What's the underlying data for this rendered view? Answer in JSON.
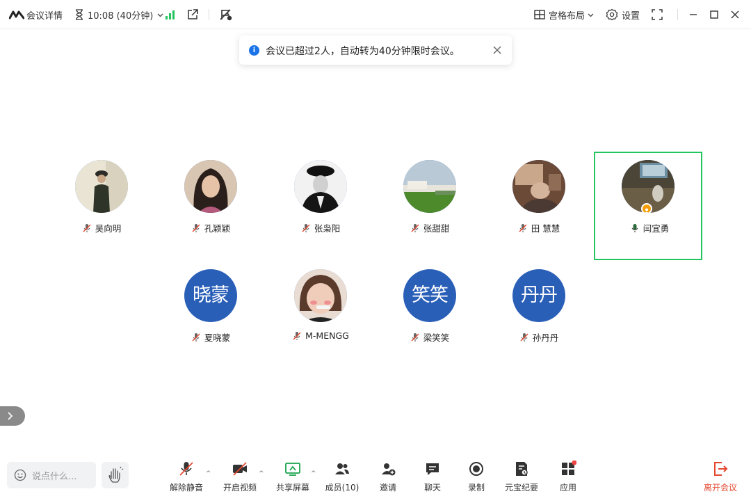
{
  "topbar": {
    "meeting_details": "会议详情",
    "timer": "10:08 (40分钟)",
    "layout": "宫格布局",
    "settings": "设置"
  },
  "toast": {
    "message": "会议已超过2人，自动转为40分钟限时会议。"
  },
  "participants": [
    {
      "name": "吴向明",
      "avatar": "photo",
      "mic": "muted"
    },
    {
      "name": "孔颖颖",
      "avatar": "photo",
      "mic": "muted"
    },
    {
      "name": "张枭阳",
      "avatar": "photo",
      "mic": "muted"
    },
    {
      "name": "张甜甜",
      "avatar": "photo",
      "mic": "muted"
    },
    {
      "name": "田 慧慧",
      "avatar": "photo",
      "mic": "muted"
    },
    {
      "name": "闫宜勇",
      "avatar": "photo",
      "mic": "on",
      "active": true,
      "host": true
    },
    {
      "name": "夏晓蒙",
      "avatar": "initials",
      "initials": "晓蒙",
      "mic": "muted"
    },
    {
      "name": "M-MENGG",
      "avatar": "photo",
      "mic": "muted"
    },
    {
      "name": "梁笑笑",
      "avatar": "initials",
      "initials": "笑笑",
      "mic": "muted"
    },
    {
      "name": "孙丹丹",
      "avatar": "initials",
      "initials": "丹丹",
      "mic": "muted"
    }
  ],
  "bottombar": {
    "chat_placeholder": "说点什么...",
    "tools": {
      "unmute": "解除静音",
      "start_video": "开启视频",
      "share_screen": "共享屏幕",
      "members": "成员(10)",
      "invite": "邀请",
      "chat": "聊天",
      "record": "录制",
      "ai_notes": "元宝纪要",
      "apps": "应用",
      "leave": "离开会议"
    }
  },
  "colors": {
    "active_border": "#22c55e",
    "initials_avatar": "#2a5fb8",
    "leave": "#e5472f",
    "signal": "#22c55e",
    "info": "#1a73e8",
    "apps_dot": "#ef4444"
  },
  "icons": [
    "logo-icon",
    "hourglass-icon",
    "chevron-down-icon",
    "signal-icon",
    "external-share-icon",
    "flag-off-icon",
    "grid-layout-icon",
    "gear-icon",
    "fullscreen-icon",
    "minimize-icon",
    "maximize-icon",
    "close-icon"
  ]
}
